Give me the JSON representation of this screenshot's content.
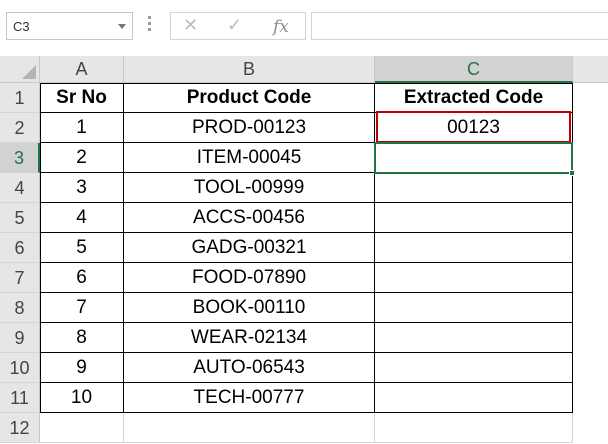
{
  "formula_bar": {
    "name_box": "C3",
    "formula": "",
    "icons": [
      "cancel-icon",
      "enter-icon",
      "fx-icon"
    ],
    "cancel_glyph": "✕",
    "enter_glyph": "✓",
    "fx_glyph": "fx"
  },
  "columns": [
    "A",
    "B",
    "C"
  ],
  "rows": [
    "1",
    "2",
    "3",
    "4",
    "5",
    "6",
    "7",
    "8",
    "9",
    "10",
    "11",
    "12"
  ],
  "active_cell": "C3",
  "highlighted_cell": "C2",
  "colors": {
    "accent": "#217346",
    "highlight": "#c00000"
  },
  "table": {
    "headers": [
      "Sr No",
      "Product Code",
      "Extracted Code"
    ],
    "rows": [
      [
        "1",
        "PROD-00123",
        "00123"
      ],
      [
        "2",
        "ITEM-00045",
        ""
      ],
      [
        "3",
        "TOOL-00999",
        ""
      ],
      [
        "4",
        "ACCS-00456",
        ""
      ],
      [
        "5",
        "GADG-00321",
        ""
      ],
      [
        "6",
        "FOOD-07890",
        ""
      ],
      [
        "7",
        "BOOK-00110",
        ""
      ],
      [
        "8",
        "WEAR-02134",
        ""
      ],
      [
        "9",
        "AUTO-06543",
        ""
      ],
      [
        "10",
        "TECH-00777",
        ""
      ]
    ]
  }
}
